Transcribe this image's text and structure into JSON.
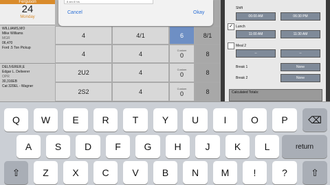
{
  "calendar": {
    "month": "Ferguson",
    "day": "24",
    "weekday": "Monday"
  },
  "employees": [
    {
      "name": "WILLIAMS,MO",
      "full": "Mike Williams",
      "role": "MGR",
      "equip_no": "06,470",
      "equip": "Ford .5 Ton Pickup"
    },
    {
      "name": "DELIVERER,E",
      "full": "Edgar L. Deliverer",
      "role": "OPR",
      "equip_no": "30,316EB",
      "equip": "Cat 320EL - Wagner"
    }
  ],
  "grid": {
    "row1": [
      "4",
      "4/1",
      "6",
      "8/1"
    ],
    "row2": [
      "4",
      "4",
      "0",
      "8"
    ],
    "row3": [
      "2U2",
      "4",
      "0",
      "8"
    ],
    "row4": [
      "2S2",
      "4",
      "0",
      "8"
    ],
    "custom_label": "Custom"
  },
  "dialog": {
    "message": "8 am 8 hrs",
    "cancel": "Cancel",
    "okay": "Okay"
  },
  "panel": {
    "shift_label": "Shift",
    "shift_start": "06:00 AM",
    "shift_end": "06:30 PM",
    "lunch_label": "Lunch",
    "lunch_checked": true,
    "lunch_start": "11:00 AM",
    "lunch_end": "11:30 AM",
    "meal2_label": "Meal 2",
    "meal2_start": "--",
    "meal2_end": "--",
    "break1_label": "Break 1",
    "break1_value": "None",
    "break2_label": "Break 2",
    "break2_value": "None",
    "totals_label": "Calculated Totals:"
  },
  "keyboard": {
    "row1": [
      "Q",
      "W",
      "E",
      "R",
      "T",
      "Y",
      "U",
      "I",
      "O",
      "P"
    ],
    "row2": [
      "A",
      "S",
      "D",
      "F",
      "G",
      "H",
      "J",
      "K",
      "L"
    ],
    "row3": [
      "Z",
      "X",
      "C",
      "V",
      "B",
      "N",
      "M",
      "!",
      "?"
    ],
    "return": "return",
    "shift": "⇧",
    "backspace": "⌫"
  }
}
